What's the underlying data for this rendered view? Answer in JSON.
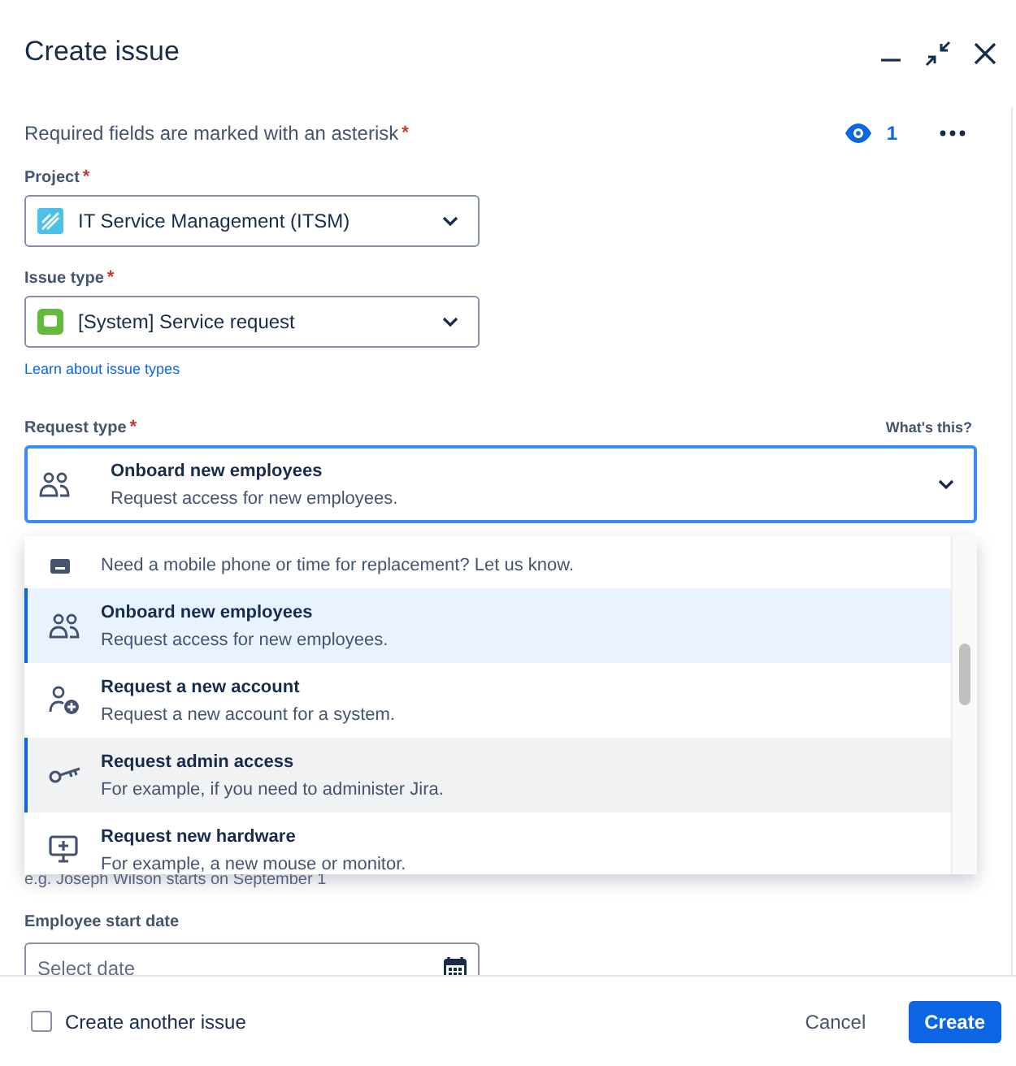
{
  "dialog": {
    "title": "Create issue"
  },
  "required_note": {
    "text": "Required fields are marked with an asterisk",
    "asterisk": "*"
  },
  "watchers": {
    "count": "1"
  },
  "project": {
    "label": "Project",
    "asterisk": "*",
    "value": "IT Service Management (ITSM)"
  },
  "issue_type": {
    "label": "Issue type",
    "asterisk": "*",
    "value": "[System] Service request",
    "link": "Learn about issue types"
  },
  "request_type": {
    "label": "Request type",
    "asterisk": "*",
    "help": "What's this?",
    "title": "Onboard new employees",
    "description": "Request access for new employees.",
    "focused": true,
    "options": [
      {
        "kind": "phone",
        "description": "Need a mobile phone or time for replacement? Let us know.",
        "selected": false,
        "highlighted": false
      },
      {
        "kind": "people",
        "title": "Onboard new employees",
        "description": "Request access for new employees.",
        "selected": true,
        "highlighted": false
      },
      {
        "kind": "person-add",
        "title": "Request a new account",
        "description": "Request a new account for a system.",
        "selected": false,
        "highlighted": false
      },
      {
        "kind": "key",
        "title": "Request admin access",
        "description": "For example, if you need to administer Jira.",
        "selected": false,
        "highlighted": true
      },
      {
        "kind": "monitor",
        "title": "Request new hardware",
        "description": "For example, a new mouse or monitor.",
        "selected": false,
        "highlighted": false
      }
    ]
  },
  "hint": "e.g. Joseph Wilson starts on September 1",
  "start_date": {
    "label": "Employee start date",
    "placeholder": "Select date"
  },
  "footer": {
    "create_another": {
      "label": "Create another issue",
      "checked": false
    },
    "buttons": [
      {
        "kind": "subtle",
        "label": "Cancel"
      },
      {
        "kind": "primary",
        "label": "Create"
      }
    ]
  }
}
